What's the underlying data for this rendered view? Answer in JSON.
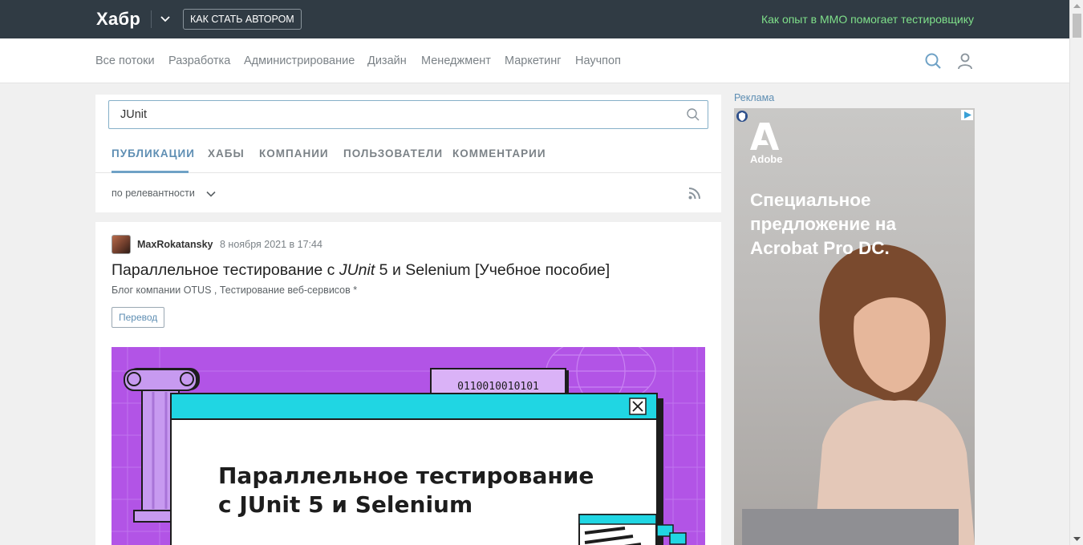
{
  "header": {
    "logo": "Хабр",
    "author_button": "КАК СТАТЬ АВТОРОМ",
    "promo_link": "Как опыт в ММО помогает тестировщику"
  },
  "nav": {
    "items": [
      "Все потоки",
      "Разработка",
      "Администрирование",
      "Дизайн",
      "Менеджмент",
      "Маркетинг",
      "Научпоп"
    ]
  },
  "search": {
    "value": "JUnit",
    "tabs": [
      "ПУБЛИКАЦИИ",
      "ХАБЫ",
      "КОМПАНИИ",
      "ПОЛЬЗОВАТЕЛИ",
      "КОММЕНТАРИИ"
    ],
    "active_tab": "ПУБЛИКАЦИИ",
    "sort_label": "по релевантности"
  },
  "article": {
    "author": "MaxRokatansky",
    "date": "8 ноября 2021 в 17:44",
    "title_before": "Параллельное тестирование с ",
    "title_italic": "JUnit",
    "title_after": " 5 и Selenium [Учебное пособие]",
    "hub1": "Блог компании OTUS",
    "hub_sep": ",",
    "hub2": "Тестирование веб-сервисов *",
    "badge": "Перевод",
    "cover": {
      "binary": "0110010010101",
      "heading_line1": "Параллельное тестирование",
      "heading_line2": "с JUnit 5 и Selenium"
    }
  },
  "sidebar": {
    "ad_label": "Реклама",
    "ad_brand": "Adobe",
    "ad_headline_1": "Специальное",
    "ad_headline_2": "предложение на",
    "ad_headline_3": "Acrobat Pro DC."
  },
  "colors": {
    "header_bg": "#303b44",
    "promo_green": "#7fe08a",
    "accent_blue": "#5e8eb3",
    "cover_purple": "#b254e6",
    "cover_cyan": "#20d6e3"
  }
}
